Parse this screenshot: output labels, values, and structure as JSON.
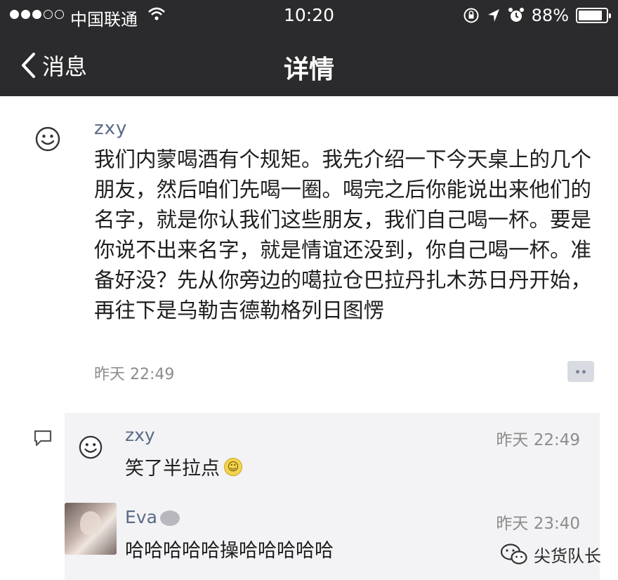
{
  "status_bar": {
    "carrier": "中国联通",
    "time": "10:20",
    "battery": "88%",
    "battery_level": 0.88
  },
  "nav": {
    "back_label": "消息",
    "title": "详情"
  },
  "post": {
    "author": "zxy",
    "text": "我们内蒙喝酒有个规矩。我先介绍一下今天桌上的几个朋友，然后咱们先喝一圈。喝完之后你能说出来他们的名字，就是你认我们这些朋友，我们自己喝一杯。要是你说不出来名字，就是情谊还没到，你自己喝一杯。准备好没？先从你旁边的噶拉仓巴拉丹扎木苏日丹开始，再往下是乌勒吉德勒格列日图愣",
    "time": "昨天 22:49"
  },
  "comments": [
    {
      "author": "zxy",
      "time": "昨天 22:49",
      "text": "笑了半拉点",
      "avatar_icon": "smiley-icon",
      "emoji": "grin-emoji"
    },
    {
      "author": "Eva",
      "time": "昨天 23:40",
      "text": "哈哈哈哈哈操哈哈哈哈哈",
      "avatar_icon": "photo-avatar"
    }
  ],
  "watermark": {
    "text": "尖货队长",
    "icon": "wechat-icon"
  },
  "colors": {
    "nav_background": "#2b2b2d",
    "name_color": "#5a6a86",
    "comment_background": "#f3f3f5"
  }
}
